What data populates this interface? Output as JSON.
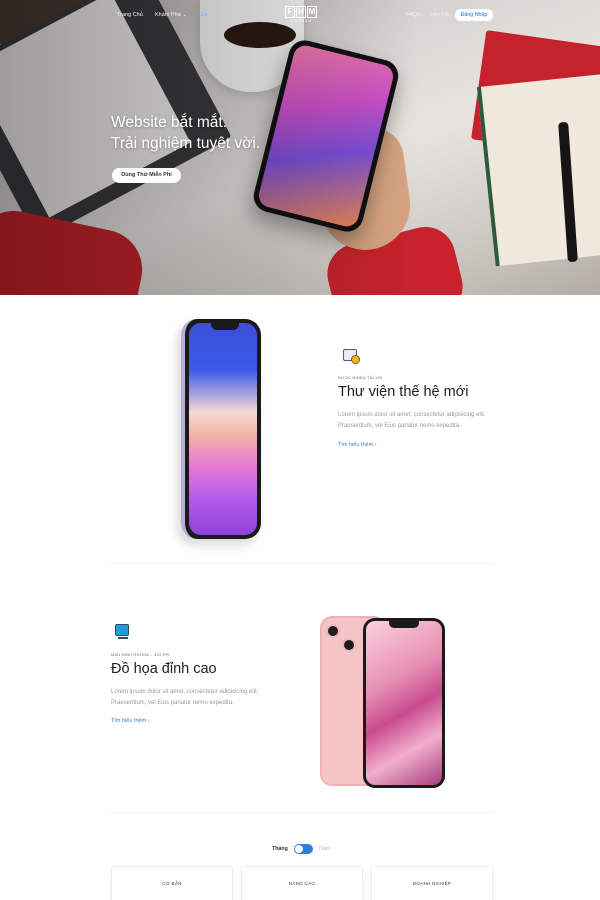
{
  "nav": {
    "links": [
      {
        "label": "Trang Chủ"
      },
      {
        "label": "Khám Phá ⌄"
      },
      {
        "label": "Giá"
      },
      {
        "label": "FAQs"
      },
      {
        "label": "Liên Hệ"
      }
    ],
    "logo_letters": [
      "F",
      "H",
      "M"
    ],
    "logo_sub": "VIETNAM",
    "login_label": "Đăng Nhập"
  },
  "hero": {
    "title_line1": "Website bắt mắt.",
    "title_line2": "Trải nghiệm tuyệt vời.",
    "cta_label": "Dùng Thử Miễn Phí"
  },
  "features": [
    {
      "icon": "library-icon",
      "kicker": "được nhiều tải xin",
      "title": "Thư viện thế hệ mới",
      "desc": "Lorem ipsum dolor sit amet, consectetur adipisicing elit. Praesentium, vel Eius pariatur nemo expedita.",
      "link": "Tìm hiểu thêm ›"
    },
    {
      "icon": "monitor-icon",
      "kicker": "màn hình retina – 331 ppi",
      "title": "Đồ họa đỉnh cao",
      "desc": "Lorem ipsum dolor sit amet, consectetur adipisicing elit. Praesentium, vel Eius pariatur nemo expedita.",
      "link": "Tìm hiểu thêm ›"
    }
  ],
  "pricing": {
    "toggle_left": "Tháng",
    "toggle_right": "Năm",
    "plans": [
      {
        "name": "CƠ BẢN"
      },
      {
        "name": "NÂNG CAO"
      },
      {
        "name": "DOANH NGHIỆP"
      }
    ]
  },
  "colors": {
    "accent": "#2f7fd8",
    "nav_active": "#6fb7ff",
    "text_dark": "#1e1e1e",
    "text_muted": "#9a9a9a"
  }
}
